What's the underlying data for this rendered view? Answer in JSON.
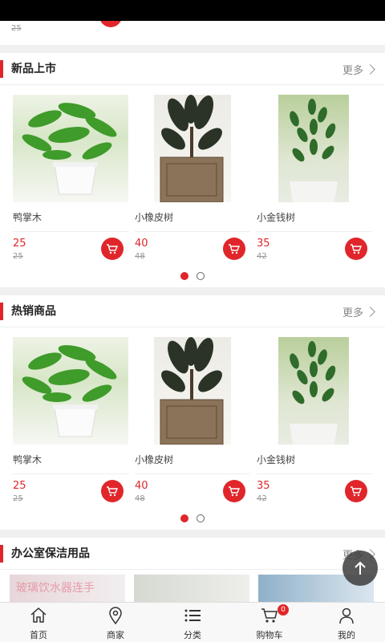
{
  "prev": {
    "old_price": "25"
  },
  "sections": [
    {
      "title": "新品上市",
      "more": "更多",
      "products": [
        {
          "name": "鸭掌木",
          "price": "25",
          "old_price": "25"
        },
        {
          "name": "小橡皮树",
          "price": "40",
          "old_price": "48"
        },
        {
          "name": "小金钱树",
          "price": "35",
          "old_price": "42"
        }
      ]
    },
    {
      "title": "热销商品",
      "more": "更多",
      "products": [
        {
          "name": "鸭掌木",
          "price": "25",
          "old_price": "25"
        },
        {
          "name": "小橡皮树",
          "price": "40",
          "old_price": "48"
        },
        {
          "name": "小金钱树",
          "price": "35",
          "old_price": "42"
        }
      ]
    },
    {
      "title": "办公室保洁用品",
      "more": "更多",
      "banner_text": "玻璃饮水器连手"
    }
  ],
  "tabbar": [
    {
      "label": "首页",
      "icon": "home-icon"
    },
    {
      "label": "商家",
      "icon": "location-pin-icon"
    },
    {
      "label": "分类",
      "icon": "list-icon"
    },
    {
      "label": "购物车",
      "icon": "cart-icon",
      "badge": "0"
    },
    {
      "label": "我的",
      "icon": "user-icon"
    }
  ],
  "colors": {
    "accent": "#e0262b",
    "status_bar": "#000000",
    "background": "#f0f0f0"
  }
}
